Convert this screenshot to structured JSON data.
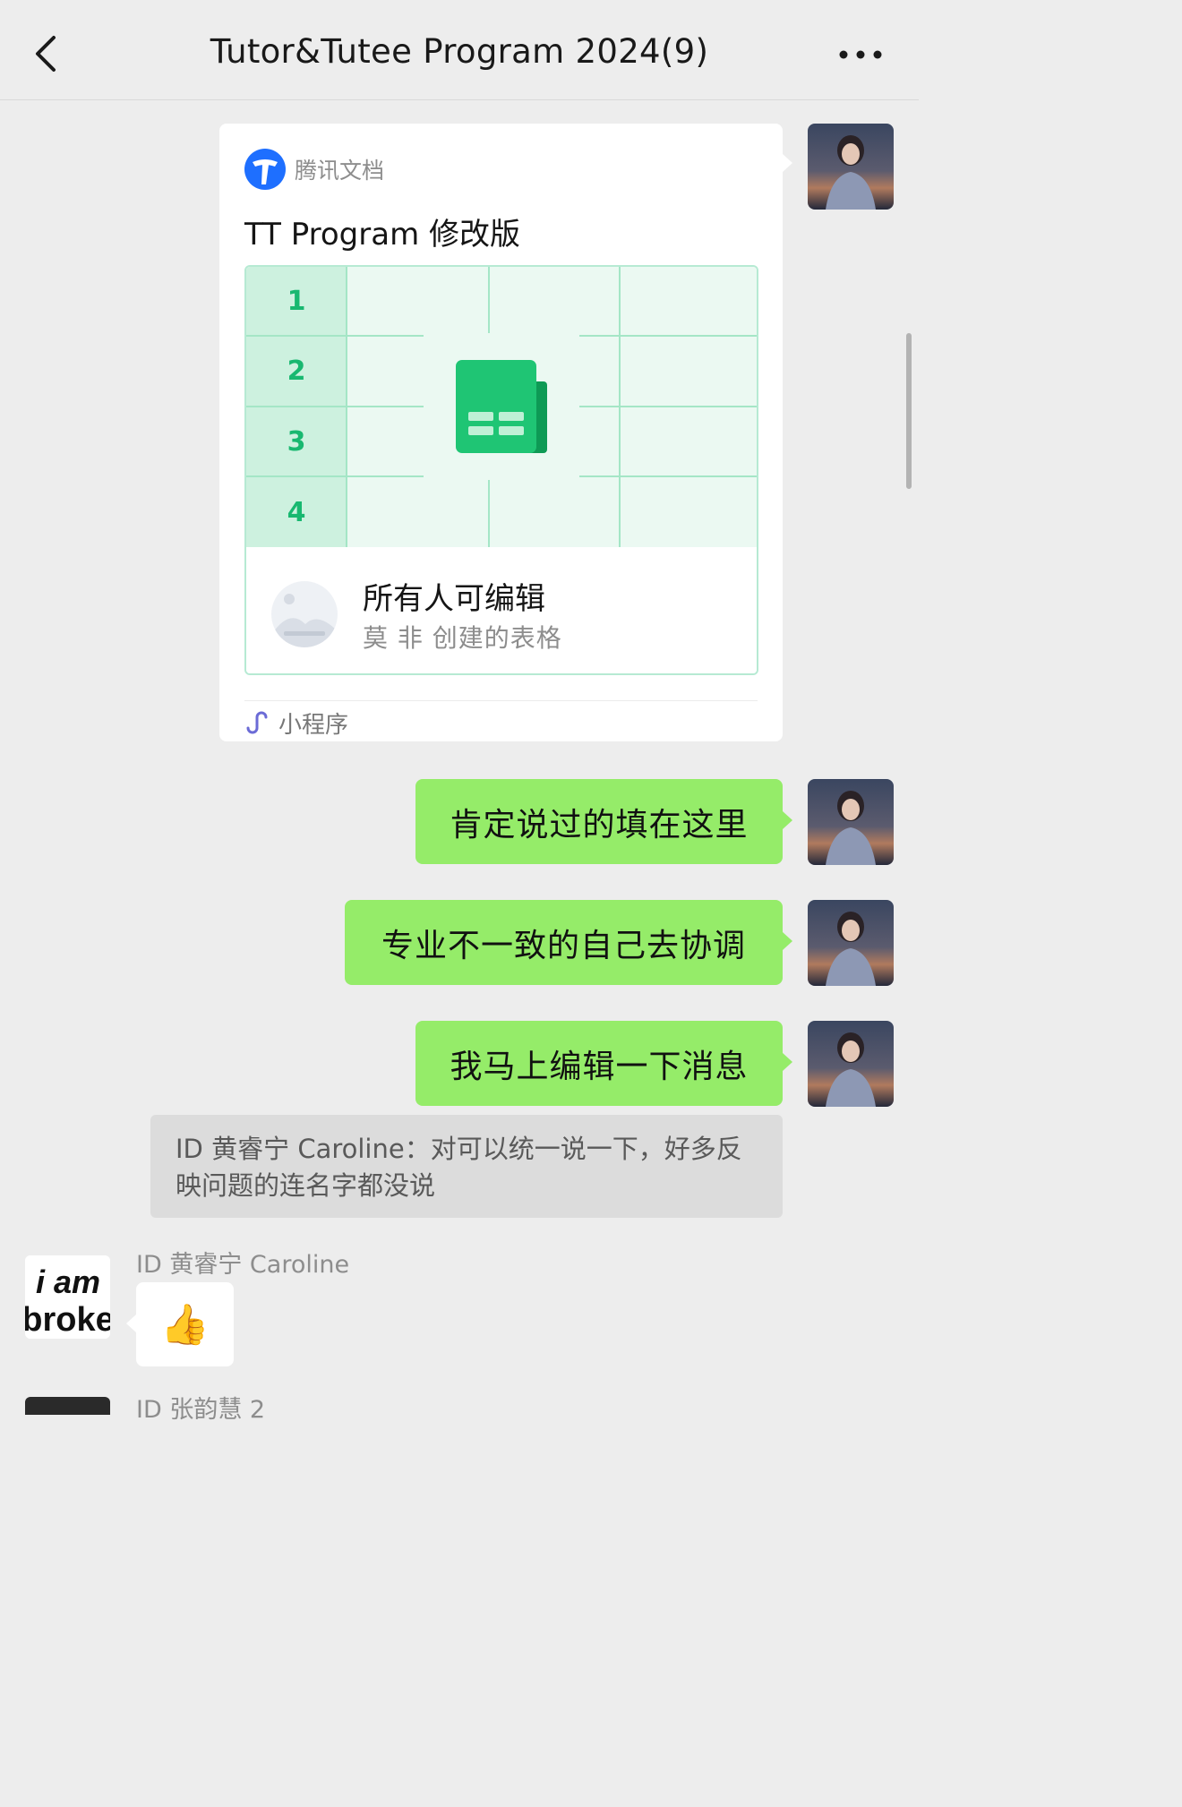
{
  "header": {
    "title": "Tutor&Tutee Program 2024(9)",
    "back_icon": "chevron-left-icon",
    "more_icon": "ellipsis-icon"
  },
  "card": {
    "brand": "腾讯文档",
    "title": "TT Program 修改版",
    "row_numbers": [
      "1",
      "2",
      "3",
      "4"
    ],
    "permission": "所有人可编辑",
    "creator": "莫 非 创建的表格",
    "mini_program_label": "小程序",
    "accent_color": "#18b870"
  },
  "messages": [
    {
      "text": "肯定说过的填在这里"
    },
    {
      "text": "专业不一致的自己去协调"
    },
    {
      "text": "我马上编辑一下消息"
    }
  ],
  "quote": {
    "text": "ID 黄睿宁 Caroline：对可以统一说一下，好多反映问题的连名字都没说"
  },
  "reply": {
    "sender": "ID 黄睿宁 Caroline",
    "emoji": "👍",
    "avatar_text_line1": "i am",
    "avatar_text_line2": "broke"
  },
  "next": {
    "sender_partial": "ID 张韵慧 2"
  },
  "colors": {
    "bubble_green": "#95ec69",
    "background": "#ededed",
    "brand_blue": "#1e6fff"
  }
}
